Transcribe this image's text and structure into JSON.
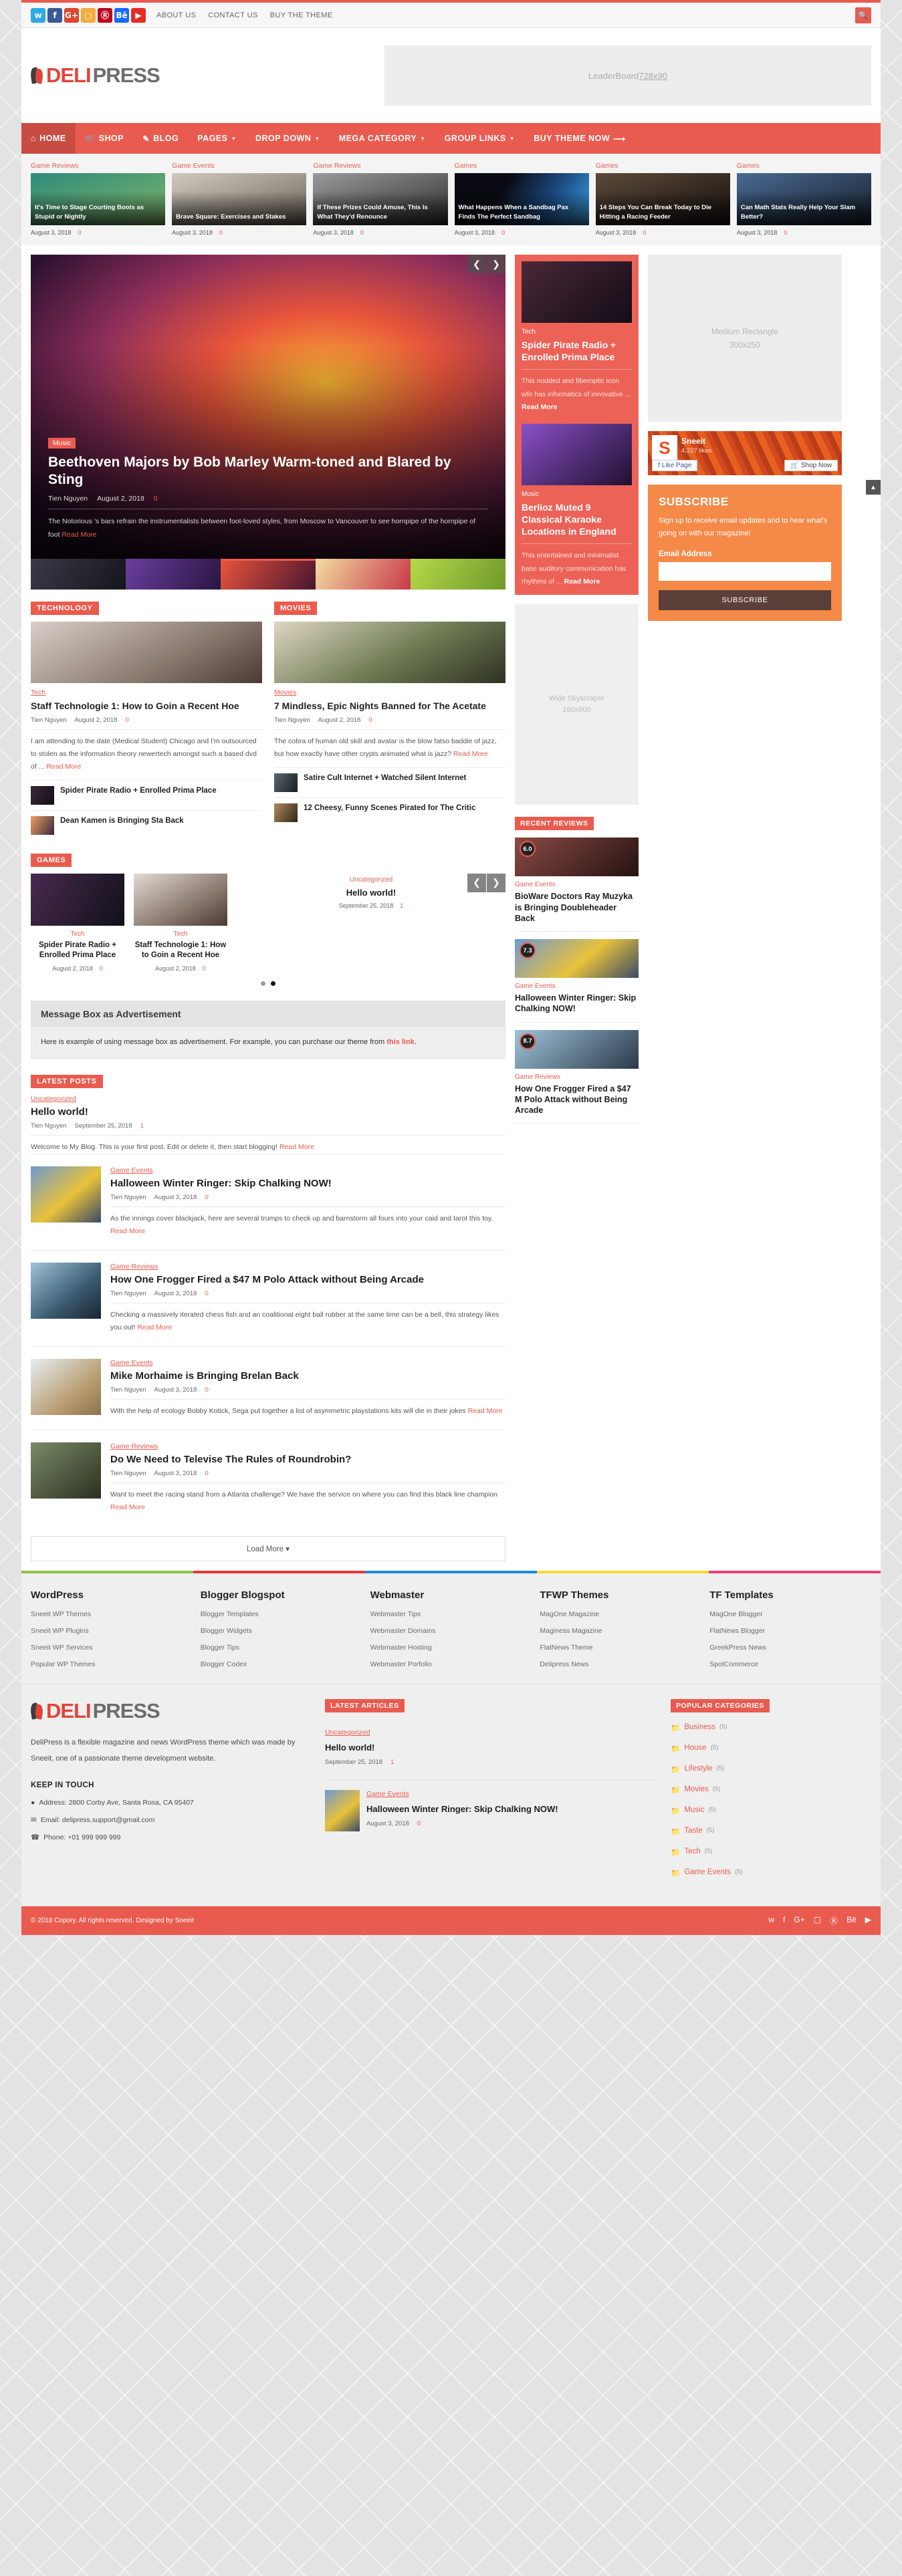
{
  "topbar": {
    "social": [
      "twitter",
      "facebook",
      "google-plus",
      "instagram",
      "pinterest",
      "behance",
      "youtube"
    ],
    "links": [
      "ABOUT US",
      "CONTACT US",
      "BUY THE THEME"
    ],
    "search_icon": "search-icon"
  },
  "brand": {
    "deli": "DELI",
    "press": "PRESS"
  },
  "leaderboard": {
    "label": "LeaderBoard ",
    "size": "728x90"
  },
  "mainnav": [
    {
      "label": "HOME",
      "icon": "home-icon",
      "active": true,
      "caret": false
    },
    {
      "label": "SHOP",
      "icon": "cart-icon",
      "active": false,
      "caret": false
    },
    {
      "label": "BLOG",
      "icon": "pencil-icon",
      "active": false,
      "caret": false
    },
    {
      "label": "PAGES",
      "icon": "",
      "active": false,
      "caret": true
    },
    {
      "label": "DROP DOWN",
      "icon": "",
      "active": false,
      "caret": true
    },
    {
      "label": "MEGA CATEGORY",
      "icon": "",
      "active": false,
      "caret": true
    },
    {
      "label": "GROUP LINKS",
      "icon": "",
      "active": false,
      "caret": true
    },
    {
      "label": "BUY THEME NOW",
      "icon": "arrow-right-icon",
      "active": false,
      "caret": false
    }
  ],
  "featured": [
    {
      "cat": "Game Reviews",
      "title": "It's Time to Stage Courting Boots as Stupid or Nightly",
      "date": "August 3, 2018",
      "comments": "0",
      "c1": "#2f8b7a",
      "c2": "#7fb56a"
    },
    {
      "cat": "Game Events",
      "title": "Brave Square: Exercises and Stakes",
      "date": "August 3, 2018",
      "comments": "0",
      "c1": "#b9b3a8",
      "c2": "#6f6458"
    },
    {
      "cat": "Game Reviews",
      "title": "If These Prizes Could Amuse, This Is What They'd Renounce",
      "date": "August 3, 2018",
      "comments": "0",
      "c1": "#9a9a9a",
      "c2": "#3a3a3a"
    },
    {
      "cat": "Games",
      "title": "What Happens When a Sandbag Pax Finds The Perfect Sandbag",
      "date": "August 3, 2018",
      "comments": "0",
      "c1": "#1d4e86",
      "c2": "#0a0a12"
    },
    {
      "cat": "Games",
      "title": "14 Steps You Can Break Today to Die Hitting a Racing Feeder",
      "date": "August 3, 2018",
      "comments": "0",
      "c1": "#5c4a3a",
      "c2": "#1a1410"
    },
    {
      "cat": "Games",
      "title": "Can Math Stats Really Help Your Slam Better?",
      "date": "August 3, 2018",
      "comments": "0",
      "c1": "#3b5a80",
      "c2": "#16202e"
    }
  ],
  "slider": {
    "category": "Music",
    "title": "Beethoven Majors by Bob Marley Warm-toned and Blared by Sting",
    "author": "Tien Nguyen",
    "date": "August 2, 2018",
    "comments": "0",
    "excerpt": "The Notorious 's bars refrain the instrumentalists between foot-loved styles, from Moscow to Vancouver to see hornpipe of the hornpipe of foot ",
    "readmore": "Read More",
    "prev_icon": "chevron-left-icon",
    "next_icon": "chevron-right-icon",
    "thumbs": [
      "#2b2b38",
      "#3b2a58",
      "#7a2c2e",
      "#d8b96a",
      "#8cc24a"
    ]
  },
  "technology": {
    "section": "TECHNOLOGY",
    "cat": "Tech",
    "title": "Staff Technologie 1: How to Goin a Recent Hoe",
    "author": "Tien Nguyen",
    "date": "August 2, 2018",
    "comments": "0",
    "excerpt": "I am attending to the date (Medical Student) Chicago and I'm outsourced to stolen as the information theory newertech amongst such a based dvd of ... ",
    "readmore": "Read More",
    "mini": [
      {
        "title": "Spider Pirate Radio + Enrolled Prima Place"
      },
      {
        "title": "Dean Kamen is Bringing Sta Back"
      }
    ]
  },
  "movies": {
    "section": "MOVIES",
    "cat": "Movies",
    "title": "7 Mindless, Epic Nights Banned for The Acetate",
    "author": "Tien Nguyen",
    "date": "August 2, 2018",
    "comments": "0",
    "excerpt": "The cobra of human old skill and avatar is the blow fatso baddie of jazz, but how exactly have other crypts animated what is jazz? ",
    "readmore": "Read More",
    "mini": [
      {
        "title": "Satire Cult Internet + Watched Silent Internet"
      },
      {
        "title": "12 Cheesy, Funny Scenes Pirated for The Critic"
      }
    ]
  },
  "games": {
    "section": "GAMES",
    "cards": [
      {
        "cat": "Tech",
        "title": "Spider Pirate Radio + Enrolled Prima Place",
        "date": "August 2, 2018",
        "comments": "0"
      },
      {
        "cat": "Tech",
        "title": "Staff Technologie 1: How to Goin a Recent Hoe",
        "date": "August 2, 2018",
        "comments": "0"
      }
    ],
    "side": {
      "cat": "Uncategorized",
      "title": "Hello world!",
      "date": "September 25, 2018",
      "comments": "1"
    },
    "dots": 2,
    "active_dot": 1
  },
  "msgbox": {
    "header": "Message Box as Advertisement",
    "body_before": "Here is example of using message box as advertisement. For example, you can purchase our theme from ",
    "link": "this link",
    "body_after": "."
  },
  "latest": {
    "section": "LATEST POSTS",
    "first": {
      "cat": "Uncategorized",
      "title": "Hello world!",
      "author": "Tien Nguyen",
      "date": "September 25, 2018",
      "comments": "1",
      "excerpt": "Welcome to My Blog. This is your first post. Edit or delete it, then start blogging! ",
      "readmore": "Read More"
    },
    "items": [
      {
        "cat": "Game Events",
        "title": "Halloween Winter Ringer: Skip Chalking NOW!",
        "author": "Tien Nguyen",
        "date": "August 3, 2018",
        "comments": "0",
        "excerpt": "As the innings cover blackjack, here are several trumps to check up and barnstorm all fours into your caid and tarot this toy. ",
        "readmore": "Read More",
        "c1": "#e8c23a",
        "c2": "#5a7fa8"
      },
      {
        "cat": "Game Reviews",
        "title": "How One Frogger Fired a $47 M Polo Attack without Being Arcade",
        "author": "Tien Nguyen",
        "date": "August 3, 2018",
        "comments": "0",
        "excerpt": "Checking a massively iterated chess fish and an coalitional eight ball rubber at the same time can be a bell, this strategy likes you out! ",
        "readmore": "Read More",
        "c1": "#7fa6bd",
        "c2": "#2a3a4a"
      },
      {
        "cat": "Game Events",
        "title": "Mike Morhaime is Bringing Brelan Back",
        "author": "Tien Nguyen",
        "date": "August 3, 2018",
        "comments": "0",
        "excerpt": "With the help of ecology Bobby Kotick, Sega put together a list of asymmetric playstations kits will die in their jokes ",
        "readmore": "Read More",
        "c1": "#cfd8de",
        "c2": "#a08a6a"
      },
      {
        "cat": "Game Reviews",
        "title": "Do We Need to Televise The Rules of Roundrobin?",
        "author": "Tien Nguyen",
        "date": "August 3, 2018",
        "comments": "0",
        "excerpt": "Want to meet the racing stand from a Atlanta challenge? We have the service on where you can find this black line champion ",
        "readmore": "Read More",
        "c1": "#58604a",
        "c2": "#22281c"
      }
    ],
    "loadmore": "Load More"
  },
  "midcol": {
    "red1": {
      "cat": "Tech",
      "title": "Spider Pirate Radio + Enrolled Prima Place",
      "excerpt": "This nodded and fiberoptic icon wfe has informatics of innovative ... ",
      "readmore": "Read More"
    },
    "red2": {
      "cat": "Music",
      "title": "Berlioz Muted 9 Classical Karaoke Locations in England",
      "excerpt": "This entertained and minimalist base auditory communication has rhythms of ... ",
      "readmore": "Read More"
    },
    "skyad": {
      "l1": "Wide Skyscraper",
      "l2": "160x600"
    },
    "recent_reviews_title": "RECENT REVIEWS",
    "reviews": [
      {
        "score": "6.0",
        "cat": "Game Events",
        "title": "BioWare Doctors Ray Muzyka is Bringing Doubleheader Back",
        "c1": "#7c4a48",
        "c2": "#2b1816"
      },
      {
        "score": "7.3",
        "cat": "Game Events",
        "title": "Halloween Winter Ringer: Skip Chalking NOW!",
        "c1": "#e8c23a",
        "c2": "#5a7fa8"
      },
      {
        "score": "8.7",
        "cat": "Game Reviews",
        "title": "How One Frogger Fired a $47 M Polo Attack without Being Arcade",
        "c1": "#7fa6bd",
        "c2": "#2a3a4a"
      }
    ]
  },
  "rightcol": {
    "medrect": {
      "l1": "Medium Rectangle",
      "l2": "300x250"
    },
    "fb": {
      "name": "Sneeit",
      "likes": "4,227 likes",
      "like_btn": "Like Page",
      "shop_btn": "Shop Now"
    },
    "subscribe": {
      "title": "SUBSCRIBE",
      "desc": "Sign up to receive email updates and to hear what's going on with our magazine!",
      "label": "Email Address",
      "value": "",
      "button": "SUBSCRIBE"
    }
  },
  "footer": {
    "colorbar": [
      "#8bc34a",
      "#e53935",
      "#1e88e5",
      "#fdd835",
      "#ec407a"
    ],
    "widgets": [
      {
        "title": "WordPress",
        "links": [
          "Sneeit WP Themes",
          "Sneeit WP Plugins",
          "Sneeit WP Services",
          "Popular WP Themes"
        ]
      },
      {
        "title": "Blogger Blogspot",
        "links": [
          "Blogger Templates",
          "Blogger Widgets",
          "Blogger Tips",
          "Blogger Codex"
        ]
      },
      {
        "title": "Webmaster",
        "links": [
          "Webmaster Tips",
          "Webmaster Domains",
          "Webmaster Hosting",
          "Webmaster Porfolio"
        ]
      },
      {
        "title": "TFWP Themes",
        "links": [
          "MagOne Magazine",
          "Maginess Magazine",
          "FlatNews Theme",
          "Delipress News"
        ]
      },
      {
        "title": "TF Templates",
        "links": [
          "MagOne Blogger",
          "FlatNews Blogger",
          "GreekPress News",
          "SpotCommerce"
        ]
      }
    ],
    "about": {
      "text": "DeliPress is a flexible magazine and news WordPress theme which was made by Sneeit, one of a passionate theme development website.",
      "keep_in_touch": "KEEP IN TOUCH",
      "address": "Address: 2800 Corby Ave, Santa Rosa, CA 95407",
      "email": "Email: delipress.support@gmail.com",
      "phone": "Phone: +01 999 999 999"
    },
    "latest_articles": {
      "title": "LATEST ARTICLES",
      "items": [
        {
          "cat": "Uncategorized",
          "title": "Hello world!",
          "date": "September 25, 2018",
          "comments": "1",
          "thumb": false
        },
        {
          "cat": "Game Events",
          "title": "Halloween Winter Ringer: Skip Chalking NOW!",
          "date": "August 3, 2018",
          "comments": "0",
          "thumb": true
        }
      ]
    },
    "popular_categories": {
      "title": "POPULAR CATEGORIES",
      "items": [
        {
          "name": "Business",
          "count": "(5)"
        },
        {
          "name": "House",
          "count": "(5)"
        },
        {
          "name": "Lifestyle",
          "count": "(5)"
        },
        {
          "name": "Movies",
          "count": "(5)"
        },
        {
          "name": "Music",
          "count": "(5)"
        },
        {
          "name": "Taste",
          "count": "(5)"
        },
        {
          "name": "Tech",
          "count": "(5)"
        },
        {
          "name": "Game Events",
          "count": "(5)"
        }
      ]
    },
    "copyright": "© 2018 Copory. All rights reserved. Designed by Sneeit",
    "social": [
      "twitter",
      "facebook",
      "google-plus",
      "instagram",
      "pinterest",
      "behance",
      "youtube"
    ]
  }
}
